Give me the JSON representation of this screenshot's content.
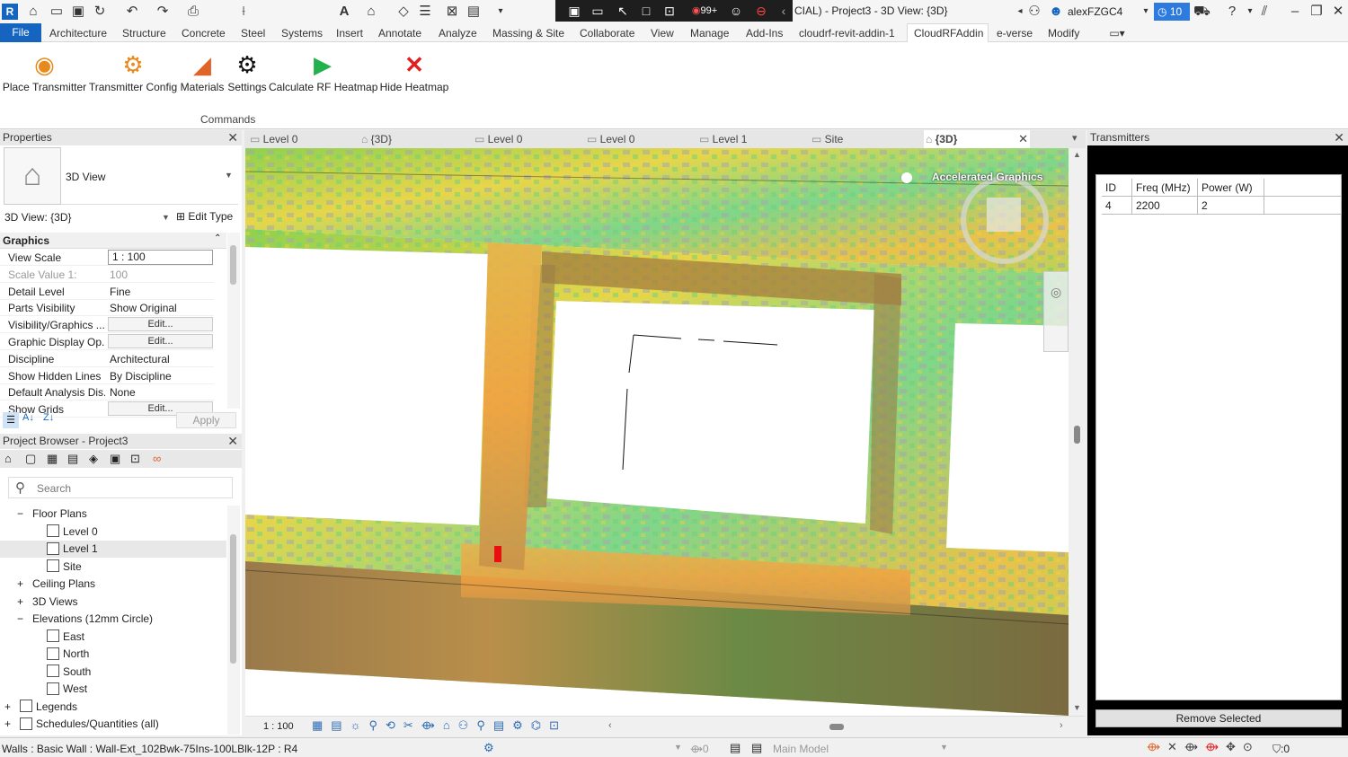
{
  "title_bar": {
    "window_title": "CIAL) - Project3 - 3D View: {3D}",
    "notification_count": "99+",
    "user_name": "alexFZGC4",
    "timer_count": "10"
  },
  "menu": {
    "file": "File",
    "items": [
      "Architecture",
      "Structure",
      "Concrete",
      "Steel",
      "Systems",
      "Insert",
      "Annotate",
      "Analyze",
      "Massing & Site",
      "Collaborate",
      "View",
      "Manage",
      "Add-Ins",
      "cloudrf-revit-addin-1",
      "CloudRFAddin",
      "e-verse",
      "Modify"
    ],
    "active": "CloudRFAddin"
  },
  "ribbon": {
    "buttons": [
      {
        "label": "Place Transmitter",
        "icon": "transmitter-icon"
      },
      {
        "label": "Transmitter Config",
        "icon": "transmitter-config-icon"
      },
      {
        "label": "Materials",
        "icon": "materials-icon"
      },
      {
        "label": "Settings",
        "icon": "gear-icon"
      },
      {
        "label": "Calculate RF Heatmap",
        "icon": "play-icon"
      },
      {
        "label": "Hide Heatmap",
        "icon": "close-icon"
      }
    ],
    "panel_label": "Commands"
  },
  "properties": {
    "header": "Properties",
    "type_name": "3D View",
    "selector": "3D View: {3D}",
    "edit_type": "Edit Type",
    "section": "Graphics",
    "rows": [
      {
        "key": "View Scale",
        "value": "1 : 100"
      },
      {
        "key": "Scale Value    1:",
        "value": "100"
      },
      {
        "key": "Detail Level",
        "value": "Fine"
      },
      {
        "key": "Parts Visibility",
        "value": "Show Original"
      },
      {
        "key": "Visibility/Graphics ...",
        "value": "Edit..."
      },
      {
        "key": "Graphic Display Op...",
        "value": "Edit..."
      },
      {
        "key": "Discipline",
        "value": "Architectural"
      },
      {
        "key": "Show Hidden Lines",
        "value": "By Discipline"
      },
      {
        "key": "Default Analysis Dis...",
        "value": "None"
      },
      {
        "key": "Show Grids",
        "value": "Edit..."
      }
    ],
    "apply": "Apply"
  },
  "browser": {
    "header": "Project Browser - Project3",
    "search_placeholder": "Search",
    "nodes": [
      {
        "label": "Floor Plans",
        "toggle": "−"
      },
      {
        "label": "Level 0"
      },
      {
        "label": "Level 1"
      },
      {
        "label": "Site"
      },
      {
        "label": "Ceiling Plans",
        "toggle": "+"
      },
      {
        "label": "3D Views",
        "toggle": "+"
      },
      {
        "label": "Elevations (12mm Circle)",
        "toggle": "−"
      },
      {
        "label": "East"
      },
      {
        "label": "North"
      },
      {
        "label": "South"
      },
      {
        "label": "West"
      },
      {
        "label": "Legends",
        "toggle": "+"
      },
      {
        "label": "Schedules/Quantities (all)",
        "toggle": "+"
      }
    ]
  },
  "view_tabs": [
    "Level 0",
    "{3D}",
    "Level 0",
    "Level 0",
    "Level 1",
    "Site",
    "{3D}"
  ],
  "viewport": {
    "overlay_text": "Accelerated Graphics",
    "scale": "1 : 100"
  },
  "transmitters": {
    "header": "Transmitters",
    "columns": [
      "ID",
      "Freq (MHz)",
      "Power (W)"
    ],
    "rows": [
      [
        "4",
        "2200",
        "2"
      ]
    ],
    "remove_button": "Remove Selected"
  },
  "status_bar": {
    "selection": "Walls : Basic Wall : Wall-Ext_102Bwk-75Ins-100LBlk-12P : R4",
    "model": "Main Model",
    "selection_count": "0",
    "filter_count": ":0"
  },
  "colors": {
    "accent": "#1565c0",
    "heat_green": "#7ed957",
    "heat_yellow": "#f2d24a",
    "heat_orange": "#f0a040"
  }
}
